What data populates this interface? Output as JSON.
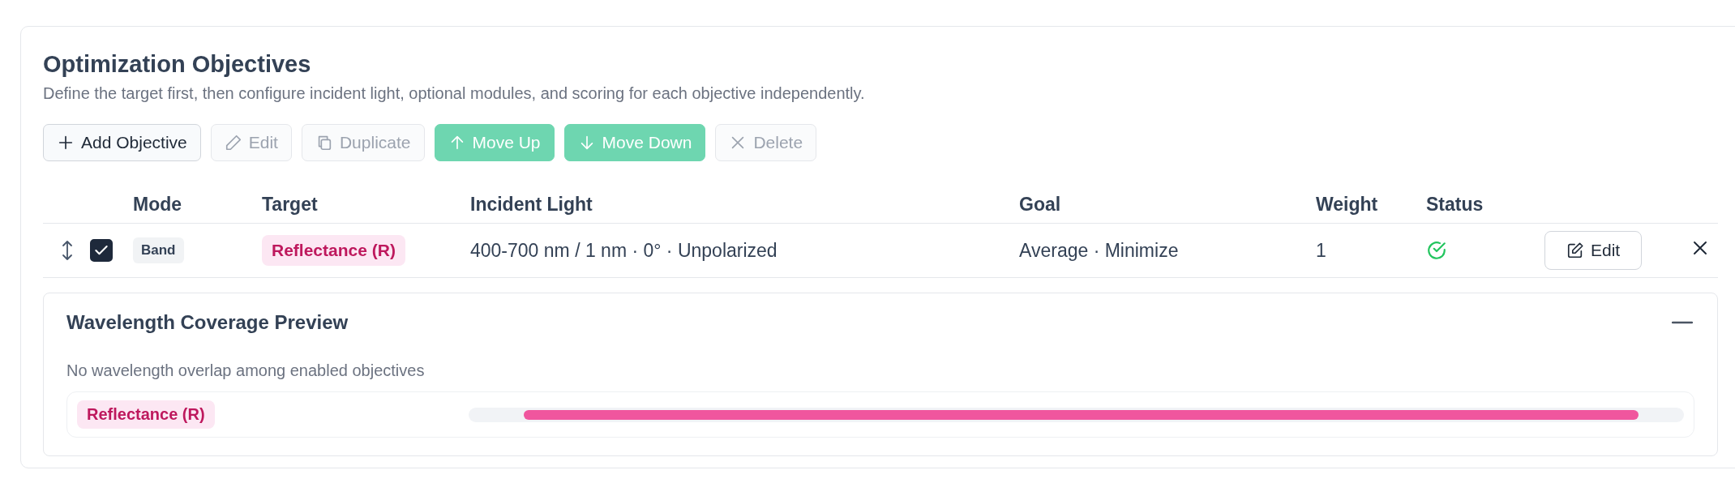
{
  "panel": {
    "title": "Optimization Objectives",
    "description": "Define the target first, then configure incident light, optional modules, and scoring for each objective independently."
  },
  "toolbar": [
    {
      "label": "Add Objective",
      "kind": "default",
      "disabled": false
    },
    {
      "label": "Edit",
      "kind": "default",
      "disabled": true
    },
    {
      "label": "Duplicate",
      "kind": "default",
      "disabled": true
    },
    {
      "label": "Move Up",
      "kind": "primary",
      "disabled": false
    },
    {
      "label": "Move Down",
      "kind": "primary",
      "disabled": false
    },
    {
      "label": "Delete",
      "kind": "default",
      "disabled": true
    }
  ],
  "table": {
    "columns": [
      "Mode",
      "Target",
      "Incident Light",
      "Goal",
      "Weight",
      "Status"
    ],
    "rows": [
      {
        "checked": true,
        "mode": "Band",
        "target": "Reflectance (R)",
        "incident_light": "400-700 nm / 1 nm · 0° · Unpolarized",
        "goal": "Average · Minimize",
        "weight": "1",
        "valid": true,
        "edit_label": "Edit"
      }
    ]
  },
  "coverage_preview": {
    "title": "Wavelength Coverage Preview",
    "expanded": true,
    "message": "No wavelength overlap among enabled objectives",
    "bars": [
      {
        "label": "Reflectance (R)"
      }
    ]
  }
}
